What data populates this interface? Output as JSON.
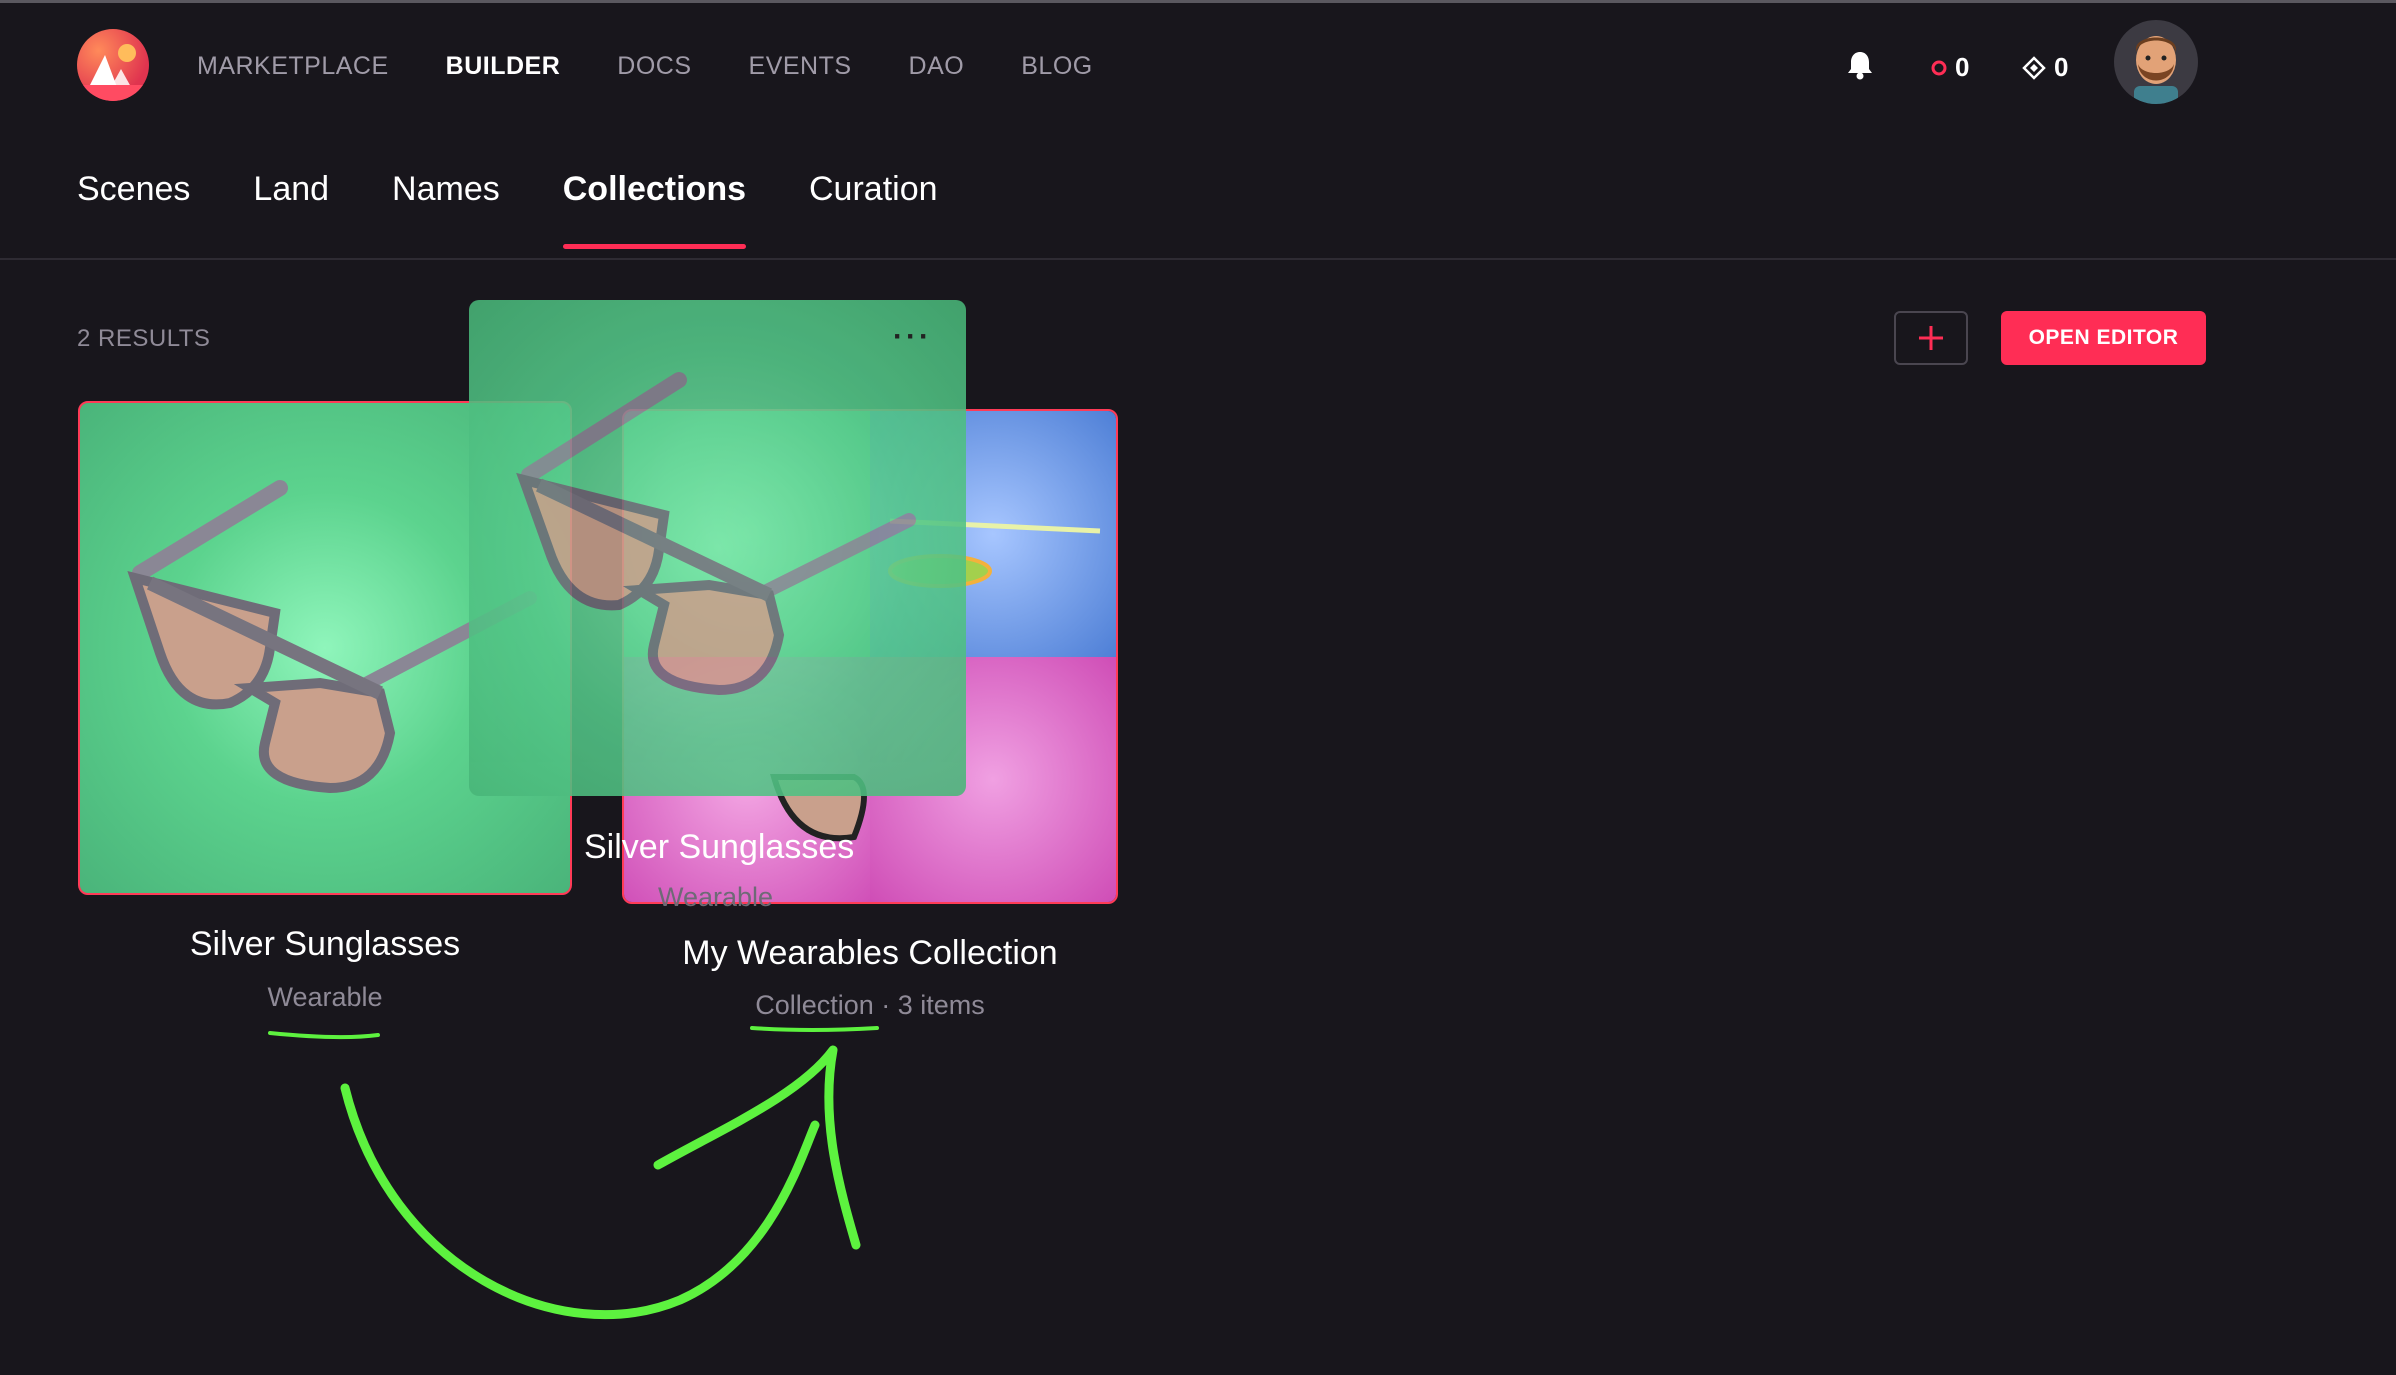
{
  "nav": {
    "items": [
      "MARKETPLACE",
      "BUILDER",
      "DOCS",
      "EVENTS",
      "DAO",
      "BLOG"
    ],
    "active": "BUILDER",
    "icons": {
      "notifications": "bell-icon",
      "mana": "mana-icon",
      "dcl": "diamond-icon"
    },
    "mana_balance": "0",
    "dcl_balance": "0"
  },
  "tabs": [
    "Scenes",
    "Land",
    "Names",
    "Collections",
    "Curation"
  ],
  "active_tab": "Collections",
  "toolbar": {
    "results": "2 RESULTS",
    "add_label": "+",
    "open_editor": "OPEN EDITOR"
  },
  "cards": [
    {
      "title": "Silver Sunglasses",
      "subtitle": "Wearable"
    },
    {
      "title": "My Wearables Collection",
      "subtitle_type": "Collection",
      "subtitle_count": " · 3 items"
    }
  ],
  "drag_ghost": {
    "title": "Silver Sunglasses",
    "subtitle": "Wearable",
    "menu": "···"
  },
  "colors": {
    "accent": "#ff2d55",
    "background": "#18161c",
    "annotation": "#5df23f"
  }
}
